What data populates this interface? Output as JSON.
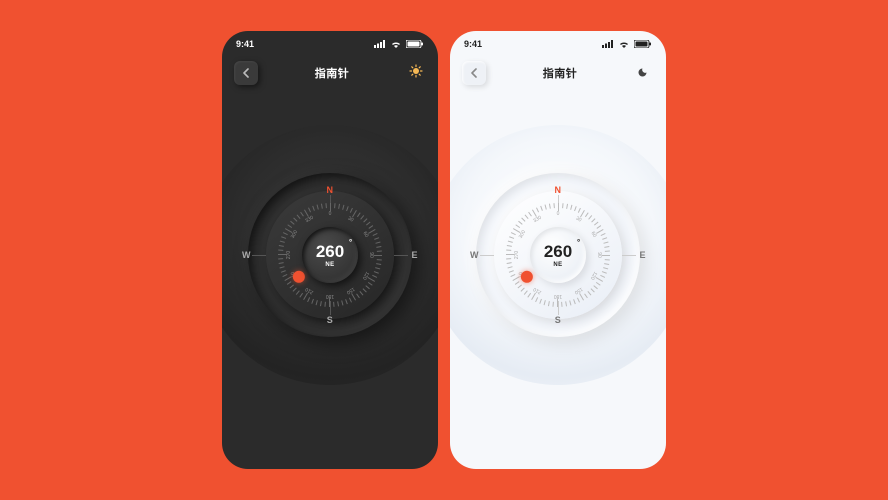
{
  "status": {
    "time": "9:41"
  },
  "header": {
    "title": "指南针"
  },
  "compass": {
    "heading_value": "260",
    "heading_unit": "°",
    "heading_direction": "NE",
    "cardinals": {
      "n": "N",
      "e": "E",
      "s": "S",
      "w": "W"
    },
    "tick_labels": [
      "0",
      "30",
      "60",
      "90",
      "120",
      "150",
      "180",
      "210",
      "240",
      "270",
      "300",
      "330"
    ]
  },
  "colors": {
    "accent": "#F05130",
    "dark_bg": "#2B2B2B",
    "light_bg": "#F6F8FB"
  },
  "themes": {
    "dark_icon": "sun",
    "light_icon": "moon"
  }
}
